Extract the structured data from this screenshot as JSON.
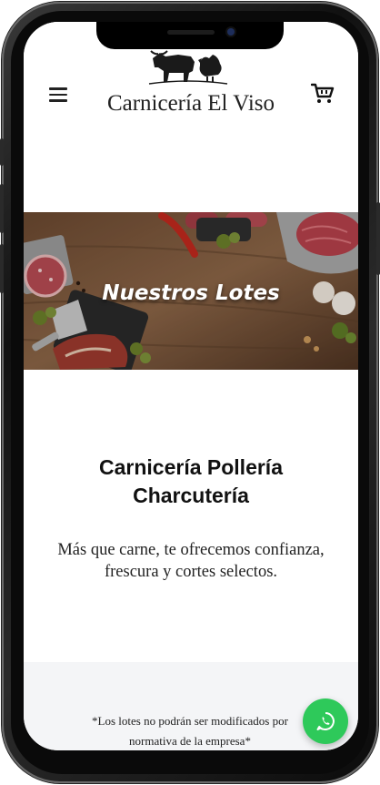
{
  "header": {
    "brand_name": "Carnicería El Viso",
    "menu_icon": "hamburger-menu-icon",
    "cart_icon": "cart-icon",
    "logo": "bull-and-hen-logo"
  },
  "banner": {
    "title": "Nuestros Lotes"
  },
  "intro": {
    "heading": "Carnicería Pollería Charcutería",
    "text": "Más que carne, te ofrecemos confianza, frescura y cortes selectos."
  },
  "notice": {
    "text": "*Los lotes no podrán ser modificados por normativa de la empresa*"
  },
  "floating": {
    "whatsapp_icon": "whatsapp-icon"
  },
  "colors": {
    "whatsapp": "#2ec95a",
    "notice_bg": "#f4f5f7"
  }
}
